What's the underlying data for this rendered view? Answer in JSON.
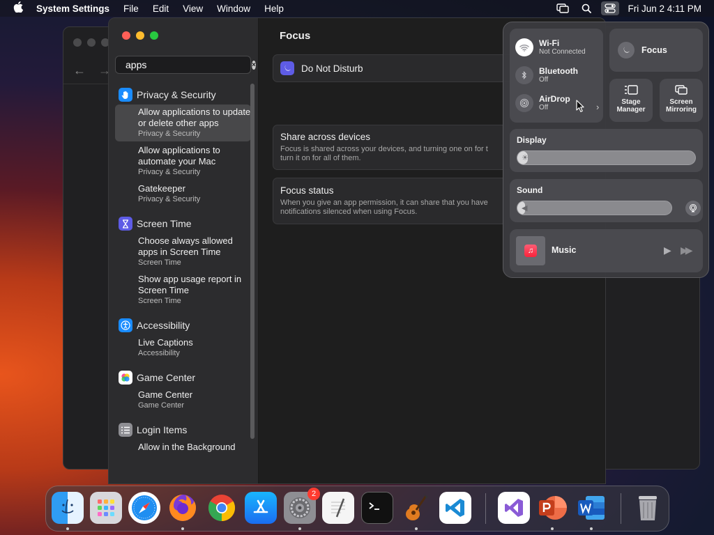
{
  "menubar": {
    "app_name": "System Settings",
    "menus": [
      "File",
      "Edit",
      "View",
      "Window",
      "Help"
    ],
    "clock": "Fri Jun 2  4:11 PM"
  },
  "sidebar": {
    "search_value": "apps",
    "groups": [
      {
        "category": "Privacy & Security",
        "icon": "hand-icon",
        "color": "#1a8cff",
        "results": [
          {
            "title": "Allow applications to update or delete other apps",
            "sub": "Privacy & Security",
            "selected": true
          },
          {
            "title": "Allow applications to automate your Mac",
            "sub": "Privacy & Security"
          },
          {
            "title": "Gatekeeper",
            "sub": "Privacy & Security"
          }
        ]
      },
      {
        "category": "Screen Time",
        "icon": "hourglass-icon",
        "color": "#5e5ce6",
        "results": [
          {
            "title": "Choose always allowed apps in Screen Time",
            "sub": "Screen Time"
          },
          {
            "title": "Show app usage report in Screen Time",
            "sub": "Screen Time"
          }
        ]
      },
      {
        "category": "Accessibility",
        "icon": "accessibility-icon",
        "color": "#1a8cff",
        "results": [
          {
            "title": "Live Captions",
            "sub": "Accessibility"
          }
        ]
      },
      {
        "category": "Game Center",
        "icon": "game-center-icon",
        "color": "#ffffff",
        "results": [
          {
            "title": "Game Center",
            "sub": "Game Center"
          }
        ]
      },
      {
        "category": "Login Items",
        "icon": "list-icon",
        "color": "#8e8e93",
        "results": [
          {
            "title": "Allow in the Background",
            "sub": ""
          }
        ]
      }
    ]
  },
  "content": {
    "title": "Focus",
    "dnd_label": "Do Not Disturb",
    "share_title": "Share across devices",
    "share_desc_1": "Focus is shared across your devices, and turning one on for t",
    "share_desc_2": "turn it on for all of them.",
    "status_title": "Focus status",
    "status_desc_1": "When you give an app permission, it can share that you have",
    "status_desc_2": "notifications silenced when using Focus."
  },
  "control_center": {
    "wifi_title": "Wi-Fi",
    "wifi_sub": "Not Connected",
    "bt_title": "Bluetooth",
    "bt_sub": "Off",
    "airdrop_title": "AirDrop",
    "airdrop_sub": "Off",
    "focus_label": "Focus",
    "stage_label_1": "Stage",
    "stage_label_2": "Manager",
    "mirror_label_1": "Screen",
    "mirror_label_2": "Mirroring",
    "display_label": "Display",
    "display_level": 0.06,
    "sound_label": "Sound",
    "sound_level": 0.05,
    "music_label": "Music"
  },
  "dock": {
    "items": [
      "finder-icon",
      "launchpad-icon",
      "safari-icon",
      "firefox-icon",
      "chrome-icon",
      "app-store-icon",
      "system-settings-icon",
      "textedit-icon",
      "terminal-icon",
      "garageband-icon",
      "vscode-icon",
      "visual-studio-icon",
      "powerpoint-icon",
      "word-icon",
      "trash-icon"
    ],
    "settings_badge": "2"
  }
}
